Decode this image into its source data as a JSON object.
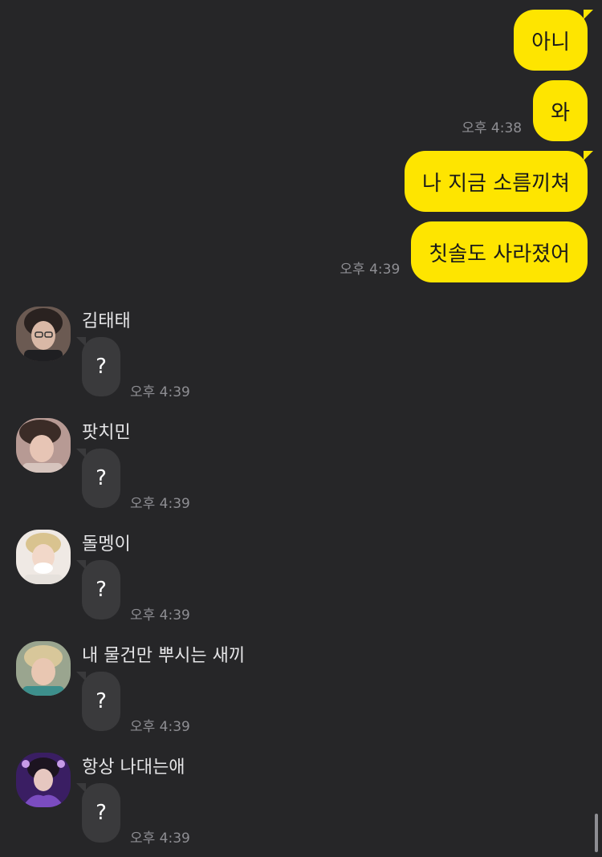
{
  "outgoing": [
    {
      "text": "아니",
      "time": ""
    },
    {
      "text": "와",
      "time": "오후 4:38"
    },
    {
      "text": "나 지금 소름끼쳐",
      "time": ""
    },
    {
      "text": "칫솔도 사라졌어",
      "time": "오후 4:39"
    }
  ],
  "incoming": [
    {
      "sender": "김태태",
      "text": "?",
      "time": "오후 4:39",
      "avatar_icon": "profile-photo-1"
    },
    {
      "sender": "팟치민",
      "text": "?",
      "time": "오후 4:39",
      "avatar_icon": "profile-photo-2"
    },
    {
      "sender": "돌멩이",
      "text": "?",
      "time": "오후 4:39",
      "avatar_icon": "profile-photo-3"
    },
    {
      "sender": "내 물건만 뿌시는 새끼",
      "text": "?",
      "time": "오후 4:39",
      "avatar_icon": "profile-photo-4"
    },
    {
      "sender": "항상 나대는애",
      "text": "?",
      "time": "오후 4:39",
      "avatar_icon": "profile-photo-5"
    }
  ],
  "colors": {
    "background": "#262628",
    "outgoing_bubble": "#fee500",
    "incoming_bubble": "#3a3a3c",
    "timestamp": "#8e8e93"
  }
}
